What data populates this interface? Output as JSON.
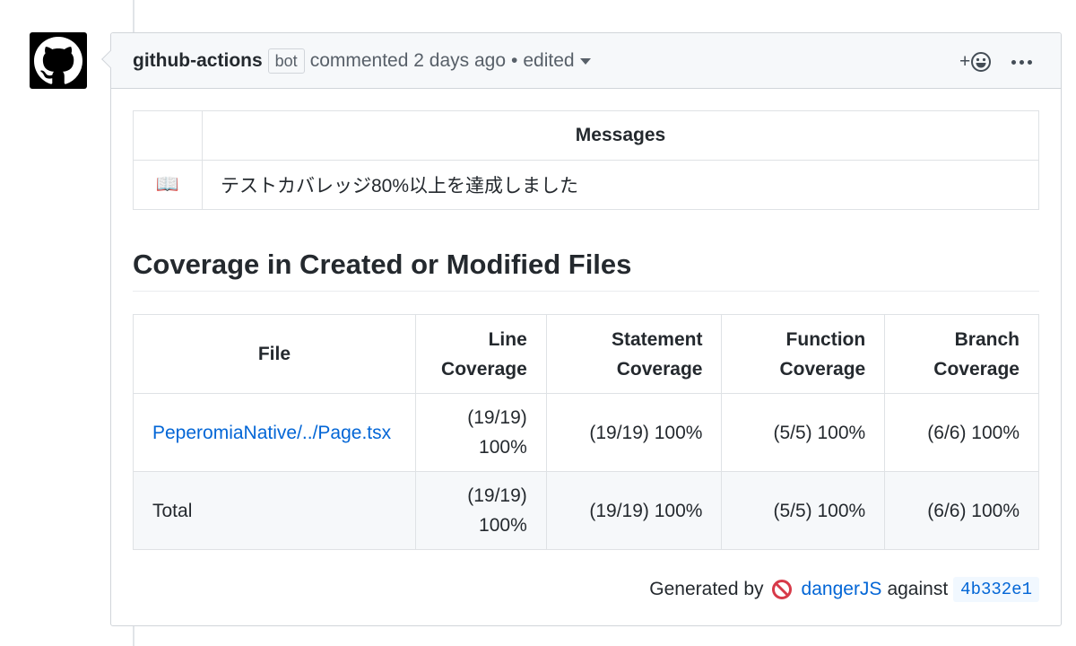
{
  "comment": {
    "author": "github-actions",
    "bot_label": "bot",
    "action": "commented",
    "time": "2 days ago",
    "separator": "•",
    "edited": "edited",
    "reaction_plus": "+"
  },
  "messages_table": {
    "header": "Messages",
    "rows": [
      {
        "icon": "📖",
        "text": "テストカバレッジ80%以上を達成しました"
      }
    ]
  },
  "coverage": {
    "title": "Coverage in Created or Modified Files",
    "headers": {
      "file": "File",
      "line_1": "Line",
      "line_2": "Coverage",
      "statement_1": "Statement",
      "statement_2": "Coverage",
      "function_1": "Function",
      "function_2": "Coverage",
      "branch_1": "Branch",
      "branch_2": "Coverage"
    },
    "rows": [
      {
        "file": "PeperomiaNative/../Page.tsx",
        "line_1": "(19/19)",
        "line_2": "100%",
        "statement": "(19/19) 100%",
        "function": "(5/5) 100%",
        "branch": "(6/6) 100%"
      },
      {
        "file": "Total",
        "line_1": "(19/19)",
        "line_2": "100%",
        "statement": "(19/19) 100%",
        "function": "(5/5) 100%",
        "branch": "(6/6) 100%"
      }
    ]
  },
  "footer": {
    "generated_by": "Generated by",
    "tool_link": "dangerJS",
    "against": "against",
    "sha": "4b332e1"
  },
  "colors": {
    "link": "#0366d6",
    "border": "#d1d5da",
    "header_bg": "#f6f8fa",
    "danger_red": "#d73a49"
  }
}
